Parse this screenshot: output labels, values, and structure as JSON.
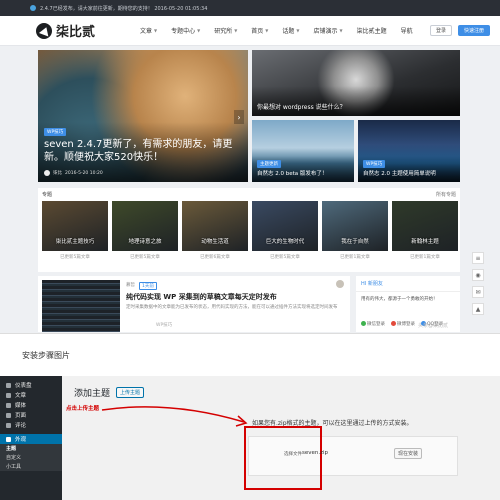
{
  "site": {
    "notice": "2.4.7已经发布，请大家前往更新，期待您的支持！ 2016-05-20 01:05:34",
    "logo_text": "柒比贰",
    "menu": [
      "文章",
      "专题中心",
      "研究所",
      "首页",
      "话题",
      "店铺演示",
      "柒比贰主题",
      "导航"
    ],
    "login_label": "登录",
    "submit_label": "快速注册"
  },
  "hero": {
    "tag": "WP技巧",
    "title": "seven 2.4.7更新了，有需求的朋友，请更新。顺便祝大家520快乐！",
    "author": "柒比",
    "date": "2016-5-20 10:20"
  },
  "side_cards": [
    {
      "tag": "",
      "title": "你最想对 wordpress 说些什么？"
    },
    {
      "tag": "主题更新",
      "title": "自然志 2.0 beta 版发布了！"
    },
    {
      "tag": "WP技巧",
      "title": "自然志 2.0 主题使用简单说明"
    }
  ],
  "topics": {
    "heading": "专题",
    "more": "所有专题",
    "items": [
      {
        "title": "柒比贰主题技巧",
        "count": "已更新5篇文章",
        "color": "#5b4a32"
      },
      {
        "title": "地理诗意之旅",
        "count": "已更新5篇文章",
        "color": "#3f4a2a"
      },
      {
        "title": "动物生活道",
        "count": "已更新6篇文章",
        "color": "#6b5a3a"
      },
      {
        "title": "巨大的生物时代",
        "count": "已更新5篇文章",
        "color": "#3a4a62"
      },
      {
        "title": "我在于自然",
        "count": "已更新1篇文章",
        "color": "#4f6a7c"
      },
      {
        "title": "新翰林主题",
        "count": "已更新1篇文章",
        "color": "#2f3a2a"
      }
    ]
  },
  "post": {
    "author": "慕哲",
    "badge": "1天前",
    "title": "纯代码实现 WP 采集到的草稿文章每天定时发布",
    "excerpt": "定时采集数据中的文章能为已发布的状态，用代码实现的方法，能在可以通过插件方法实现将选定时间发布",
    "tag": "WP技巧"
  },
  "widget": {
    "heading": "HI 新朋友",
    "body": "用有的伟大，都源于一个勇敢的开始！",
    "chips": [
      {
        "label": "微信登录",
        "color": "#3fb24f"
      },
      {
        "label": "微博登录",
        "color": "#e24a3b"
      },
      {
        "label": "QQ登录",
        "color": "#3e8ee6"
      }
    ]
  },
  "watermark": "头条@柒比贰",
  "caption": "安装步骤图片",
  "wp_admin": {
    "menu": [
      "仪表盘",
      "文章",
      "媒体",
      "页面",
      "评论"
    ],
    "active": "外观",
    "submenu": [
      "主题",
      "自定义",
      "小工具"
    ],
    "title": "添加主题",
    "upload_btn": "上传主题",
    "annotation": "点击上传主题",
    "upload_text": "如果您有.zip格式的主题，可以在这里通过上传的方式安装。",
    "file_label": "选择文件",
    "file_name": "seven.zip",
    "install_btn": "现在安装"
  }
}
